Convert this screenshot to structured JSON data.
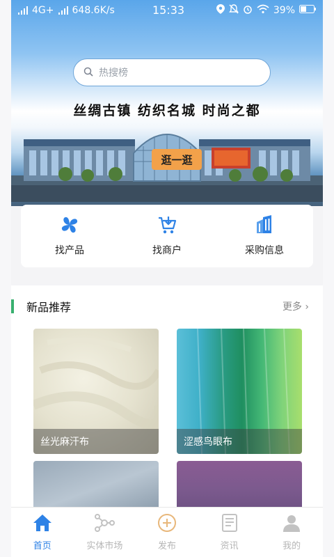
{
  "status": {
    "network": "4G+",
    "speed": "648.6K/s",
    "time": "15:33",
    "battery": "39%"
  },
  "search": {
    "placeholder": "热搜榜"
  },
  "banner": {
    "slogan": "丝绸古镇  纺织名城  时尚之都",
    "cta": "逛一逛"
  },
  "quick": [
    {
      "label": "找产品",
      "icon": "product-icon"
    },
    {
      "label": "找商户",
      "icon": "cart-icon"
    },
    {
      "label": "采购信息",
      "icon": "building-icon"
    }
  ],
  "newProducts": {
    "title": "新品推荐",
    "more": "更多",
    "items": [
      {
        "name": "丝光麻汗布"
      },
      {
        "name": "涩感鸟眼布"
      },
      {
        "name": ""
      },
      {
        "name": ""
      }
    ]
  },
  "tabs": [
    {
      "label": "首页",
      "active": true,
      "icon": "home-icon"
    },
    {
      "label": "实体市场",
      "active": false,
      "icon": "network-icon"
    },
    {
      "label": "发布",
      "active": false,
      "icon": "plus-circle-icon"
    },
    {
      "label": "资讯",
      "active": false,
      "icon": "news-icon"
    },
    {
      "label": "我的",
      "active": false,
      "icon": "user-icon"
    }
  ],
  "colors": {
    "accent": "#2e82e6",
    "sectionBar": "#39b06f",
    "cta": "#f2a14a"
  }
}
